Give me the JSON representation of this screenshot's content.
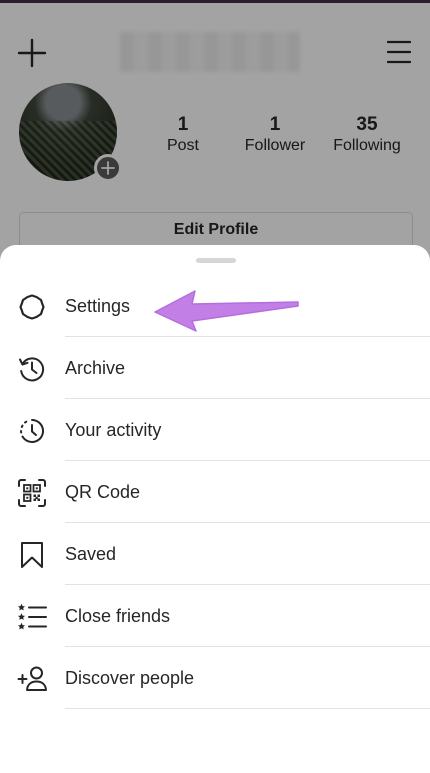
{
  "profile": {
    "stats": [
      {
        "value": "1",
        "label": "Post"
      },
      {
        "value": "1",
        "label": "Follower"
      },
      {
        "value": "35",
        "label": "Following"
      }
    ],
    "edit_profile_label": "Edit Profile"
  },
  "menu": {
    "items": [
      {
        "label": "Settings",
        "icon": "settings-gear-icon"
      },
      {
        "label": "Archive",
        "icon": "archive-clock-icon"
      },
      {
        "label": "Your activity",
        "icon": "activity-clock-icon"
      },
      {
        "label": "QR Code",
        "icon": "qr-code-icon"
      },
      {
        "label": "Saved",
        "icon": "bookmark-icon"
      },
      {
        "label": "Close friends",
        "icon": "close-friends-list-icon"
      },
      {
        "label": "Discover people",
        "icon": "add-person-icon"
      }
    ]
  },
  "colors": {
    "annotation_arrow": "#c27fe6",
    "overlay": "#000000",
    "text": "#262626",
    "divider": "#e2e2e2"
  }
}
